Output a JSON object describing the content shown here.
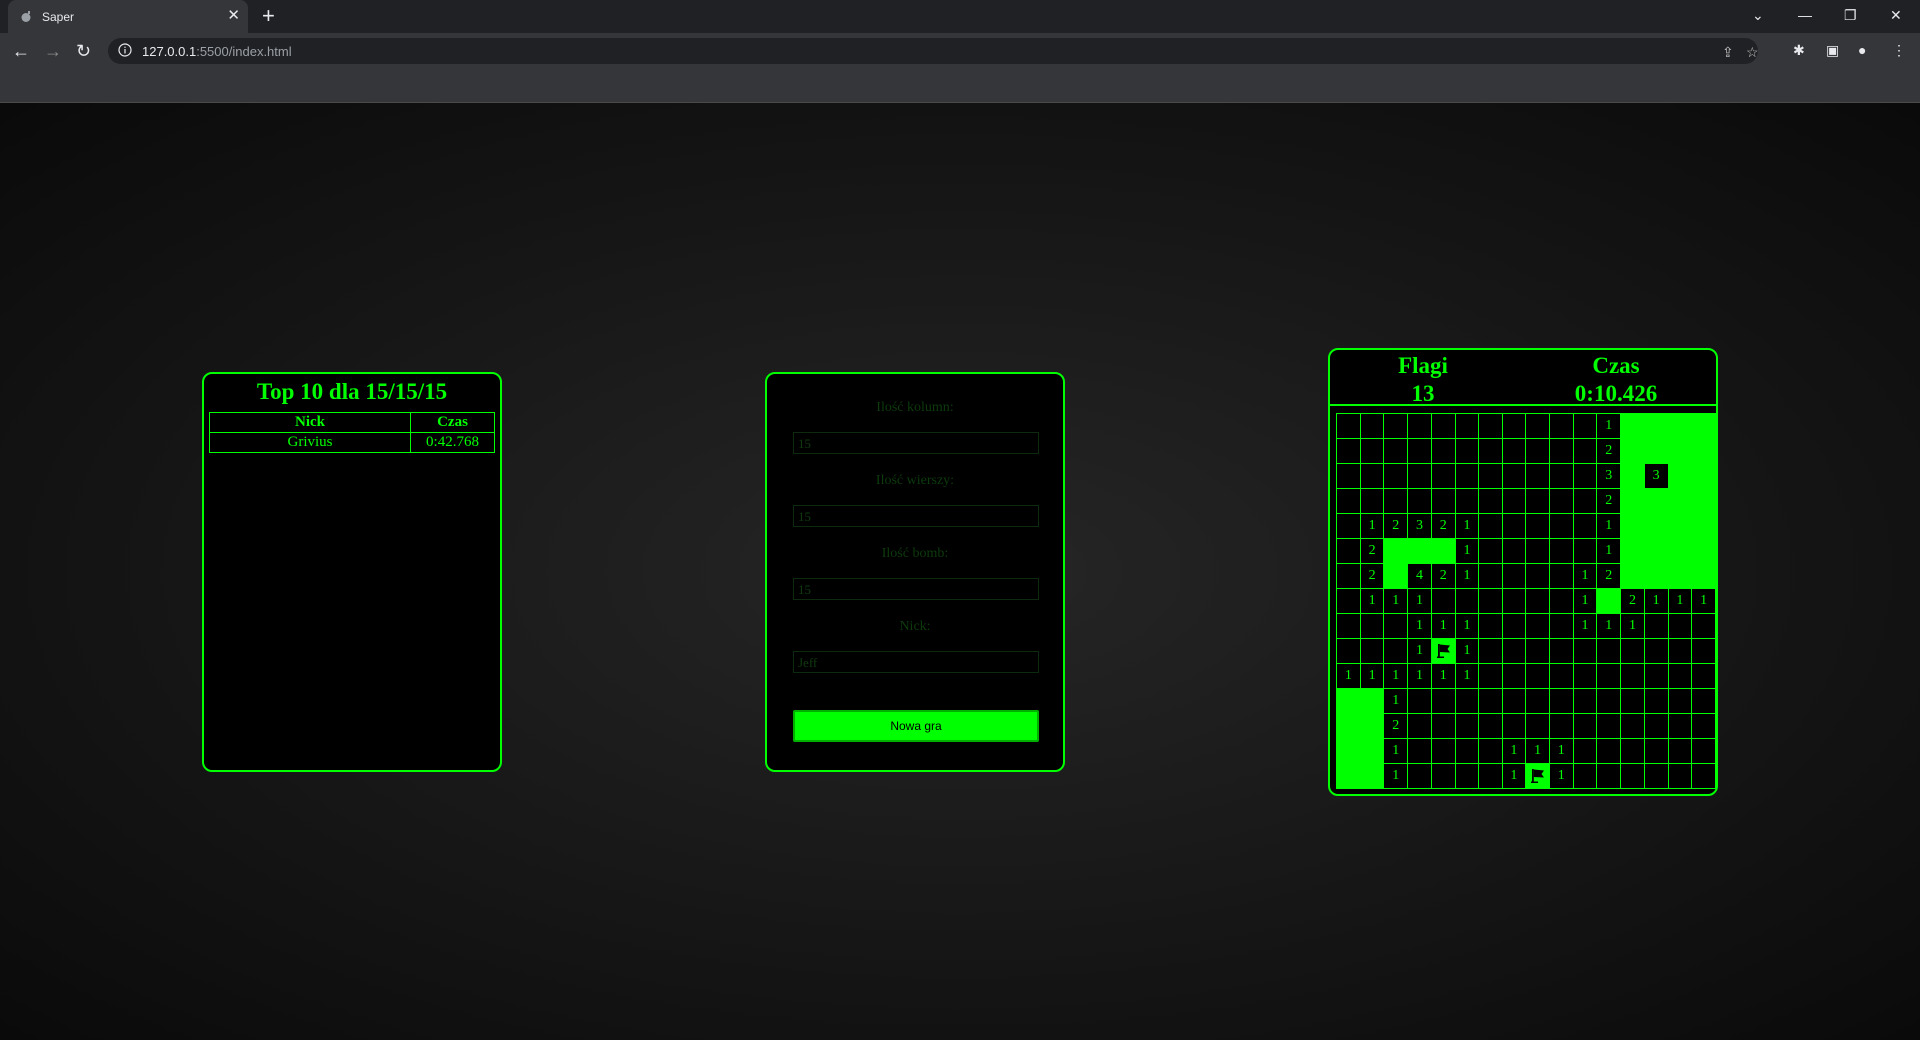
{
  "browser": {
    "tab_title": "Saper",
    "url_host": "127.0.0.1",
    "url_rest": ":5500/index.html"
  },
  "scoreboard": {
    "title": "Top 10 dla 15/15/15",
    "headers": [
      "Nick",
      "Czas"
    ],
    "rows": [
      {
        "nick": "Grivius",
        "time": "0:42.768"
      }
    ]
  },
  "form": {
    "columns_label": "Ilość kolumn:",
    "columns_value": "15",
    "rows_label": "Ilość wierszy:",
    "rows_value": "15",
    "bombs_label": "Ilość bomb:",
    "bombs_value": "15",
    "nick_label": "Nick:",
    "nick_value": "Jeff",
    "new_game_label": "Nowa gra"
  },
  "game": {
    "flags_label": "Flagi",
    "flags_value": "13",
    "time_label": "Czas",
    "time_value": "0:10.426",
    "grid_legend": {
      ".": "revealed empty",
      "#": "unrevealed",
      "F": "flag",
      "1-8": "adjacent bomb count"
    },
    "grid": [
      ". . . . . . . . . . . 1 # # # #",
      ". . . . . . . . . . . 2 # # # #",
      ". . . . . . . . . . . 3 # 3 # #",
      ". . . . . . . . . . . 2 # # # #",
      ". 1 2 3 2 1 . . . . . 1 # # # #",
      ". 2 # # # 1 . . . . . 1 # # # #",
      ". 2 # 4 2 1 . . . . 1 2 # # # #",
      ". 1 1 1 . . . . . . 1 # 2 1 1 1",
      ". . . 1 1 1 . . . . 1 1 1 . . .",
      ". . . 1 F 1 . . . . . . . . . .",
      "1 1 1 1 1 1 . . . . . . . . . .",
      "# # 1 . . . . . . . . . . . . .",
      "# # 2 . . . . . . . . . . . . .",
      "# # 1 . . . . 1 1 1 . . . . . .",
      "# # 1 . . . . 1 F 1 . . . . . ."
    ]
  }
}
